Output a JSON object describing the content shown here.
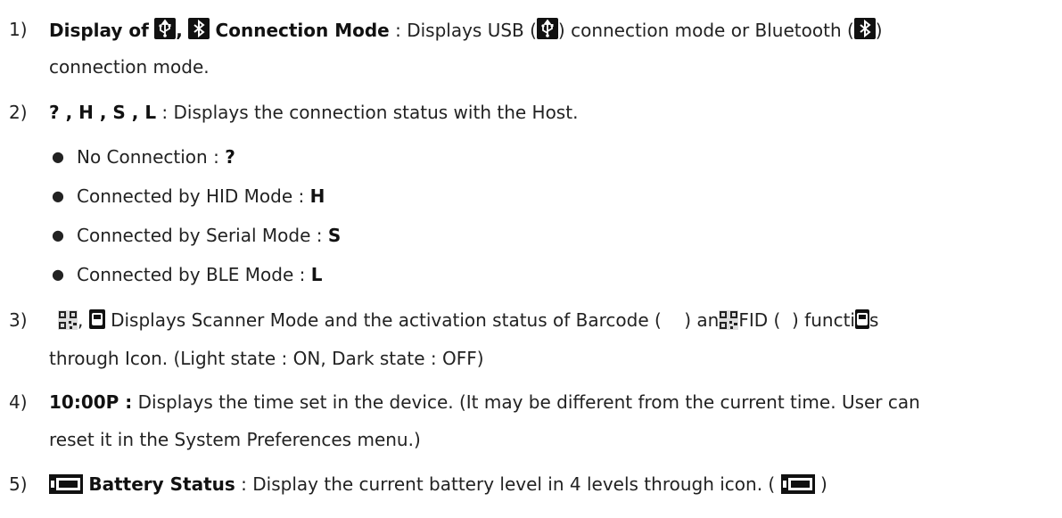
{
  "items": [
    {
      "num": "1)",
      "term_a": "Display of",
      "term_sep": ",",
      "term_b": "Connection Mode",
      "desc_a": ": Displays USB (",
      "desc_b": ") connection mode or Bluetooth (",
      "desc_c": ")",
      "desc_cont": "connection mode."
    },
    {
      "num": "2)",
      "term": "? , H , S , L",
      "desc": ": Displays the connection status with the Host.",
      "bullets": [
        {
          "label": "No Connection :",
          "value": "?"
        },
        {
          "label": "Connected by HID Mode :",
          "value": "H"
        },
        {
          "label": "Connected by Serial Mode :",
          "value": "S"
        },
        {
          "label": "Connected by BLE Mode :",
          "value": "L"
        }
      ]
    },
    {
      "num": "3)",
      "sep": ",",
      "desc_a": "Displays Scanner Mode and the activation status of Barcode (",
      "desc_b": ") an",
      "desc_c": "FID (",
      "desc_d": ") functi",
      "desc_e": "s",
      "desc_cont": "through Icon. (Light state : ON, Dark state : OFF)"
    },
    {
      "num": "4)",
      "term": "10:00P :",
      "desc": "Displays the time set in the device. (It may be different from the current time. User can",
      "desc_cont": "reset it in the System Preferences menu.)"
    },
    {
      "num": "5)",
      "term": "Battery Status",
      "desc_a": ": Display the current battery level in 4 levels through icon. (",
      "desc_b": ")"
    }
  ],
  "icons": [
    "usb-icon",
    "bluetooth-icon",
    "qr-code-icon",
    "rfid-icon",
    "battery-icon"
  ]
}
